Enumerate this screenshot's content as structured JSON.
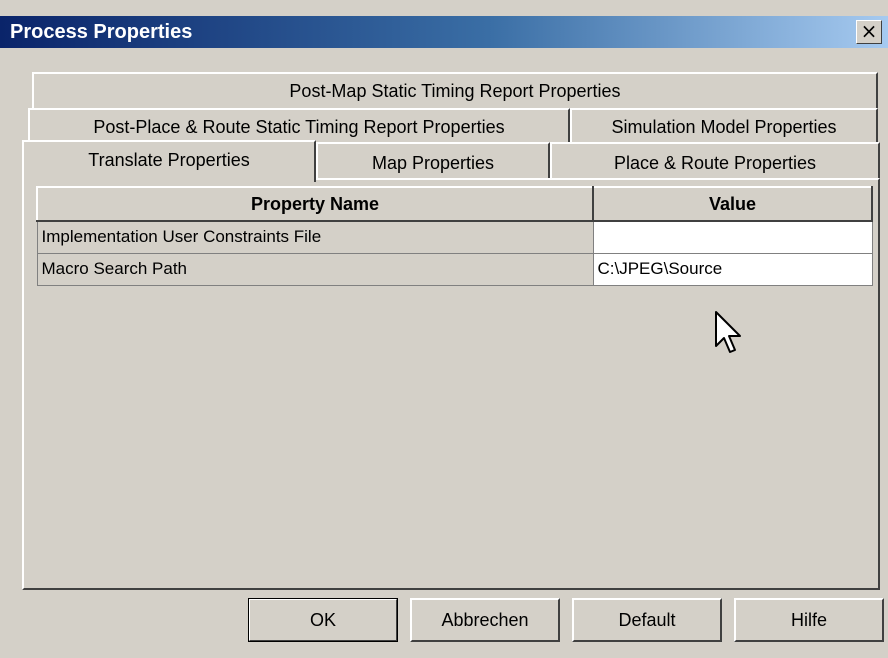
{
  "window": {
    "title": "Process Properties",
    "close_label": "×"
  },
  "tabs": {
    "row1": [
      "Post-Map Static Timing Report Properties"
    ],
    "row2": [
      "Post-Place & Route Static Timing Report Properties",
      "Simulation Model Properties"
    ],
    "row3": [
      "Translate Properties",
      "Map Properties",
      "Place & Route Properties"
    ],
    "active": "Translate Properties"
  },
  "table": {
    "columns": [
      "Property Name",
      "Value"
    ],
    "rows": [
      {
        "name": "Implementation User Constraints File",
        "value": ""
      },
      {
        "name": "Macro Search Path",
        "value": "C:\\JPEG\\Source"
      }
    ]
  },
  "buttons": {
    "ok": "OK",
    "cancel": "Abbrechen",
    "default": "Default",
    "help": "Hilfe"
  },
  "colors": {
    "titlebar_start": "#0a246a",
    "titlebar_end": "#a6caf0",
    "face": "#d4d0c8"
  },
  "icons": {
    "cursor": "arrow-cursor-icon"
  }
}
